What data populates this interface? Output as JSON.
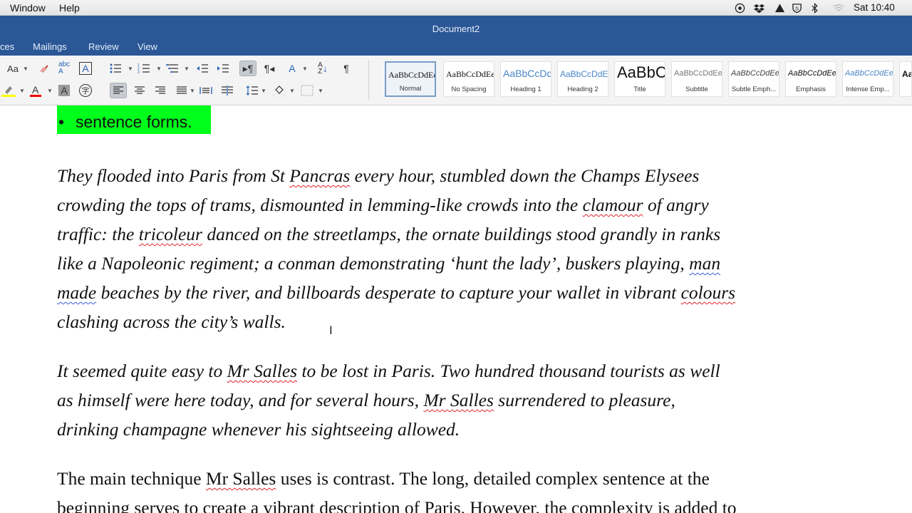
{
  "menubar": {
    "items": [
      "Window",
      "Help"
    ],
    "clock": "Sat 10:40"
  },
  "window": {
    "title": "Document2"
  },
  "tabs": [
    "ces",
    "Mailings",
    "Review",
    "View"
  ],
  "styles": [
    {
      "preview": "AaBbCcDdEe",
      "label": "Normal",
      "color": "#111111"
    },
    {
      "preview": "AaBbCcDdEe",
      "label": "No Spacing",
      "color": "#111111"
    },
    {
      "preview": "AaBbCcDd",
      "label": "Heading 1",
      "color": "#4a86c5"
    },
    {
      "preview": "AaBbCcDdEe",
      "label": "Heading 2",
      "color": "#4a86c5"
    },
    {
      "preview": "AaBbC",
      "label": "Title",
      "color": "#111111"
    },
    {
      "preview": "AaBbCcDdEe",
      "label": "Subtitle",
      "color": "#666666"
    },
    {
      "preview": "AaBbCcDdEe",
      "label": "Subtle Emph...",
      "color": "#444444"
    },
    {
      "preview": "AaBbCcDdEe",
      "label": "Emphasis",
      "color": "#111111"
    },
    {
      "preview": "AaBbCcDdEe",
      "label": "Intense Emp...",
      "color": "#4a86c5"
    },
    {
      "preview": "Aa",
      "label": "",
      "color": "#111111"
    }
  ],
  "document": {
    "bullet": "sentence forms.",
    "para1": [
      [
        "They flooded into Paris from St ",
        {
          "t": "Pancras",
          "u": "red"
        },
        " every hour, stumbled down the Champs Elysees"
      ],
      [
        "crowding the tops of trams, dismounted in lemming-like crowds into the ",
        {
          "t": "clamour",
          "u": "red"
        },
        " of angry"
      ],
      [
        "traffic: the ",
        {
          "t": "tricoleur",
          "u": "red"
        },
        " danced on the streetlamps, the ornate buildings stood grandly in ranks"
      ],
      [
        "like a Napoleonic regiment; a conman demonstrating ‘hunt the lady’, buskers playing, ",
        {
          "t": "man",
          "u": "blue"
        }
      ],
      [
        {
          "t": "made",
          "u": "blue"
        },
        " beaches by the river, and billboards desperate to capture your wallet in vibrant ",
        {
          "t": "colours",
          "u": "red"
        }
      ],
      [
        "clashing across the city’s walls."
      ]
    ],
    "para2": [
      [
        "It seemed quite easy to ",
        {
          "t": "Mr Salles",
          "u": "red"
        },
        " to be lost in Paris. Two hundred thousand tourists as well"
      ],
      [
        "as himself were here today, and for several hours, ",
        {
          "t": "Mr Salles",
          "u": "red"
        },
        " surrendered to pleasure,"
      ],
      [
        "drinking champagne whenever his sightseeing allowed."
      ]
    ],
    "para3": [
      [
        "The main technique ",
        {
          "t": "Mr Salles",
          "u": "red"
        },
        " uses is contrast. The long, detailed complex sentence at the"
      ],
      [
        "beginning serves to create a vibrant description of Paris. However, the complexity is added to"
      ]
    ]
  }
}
